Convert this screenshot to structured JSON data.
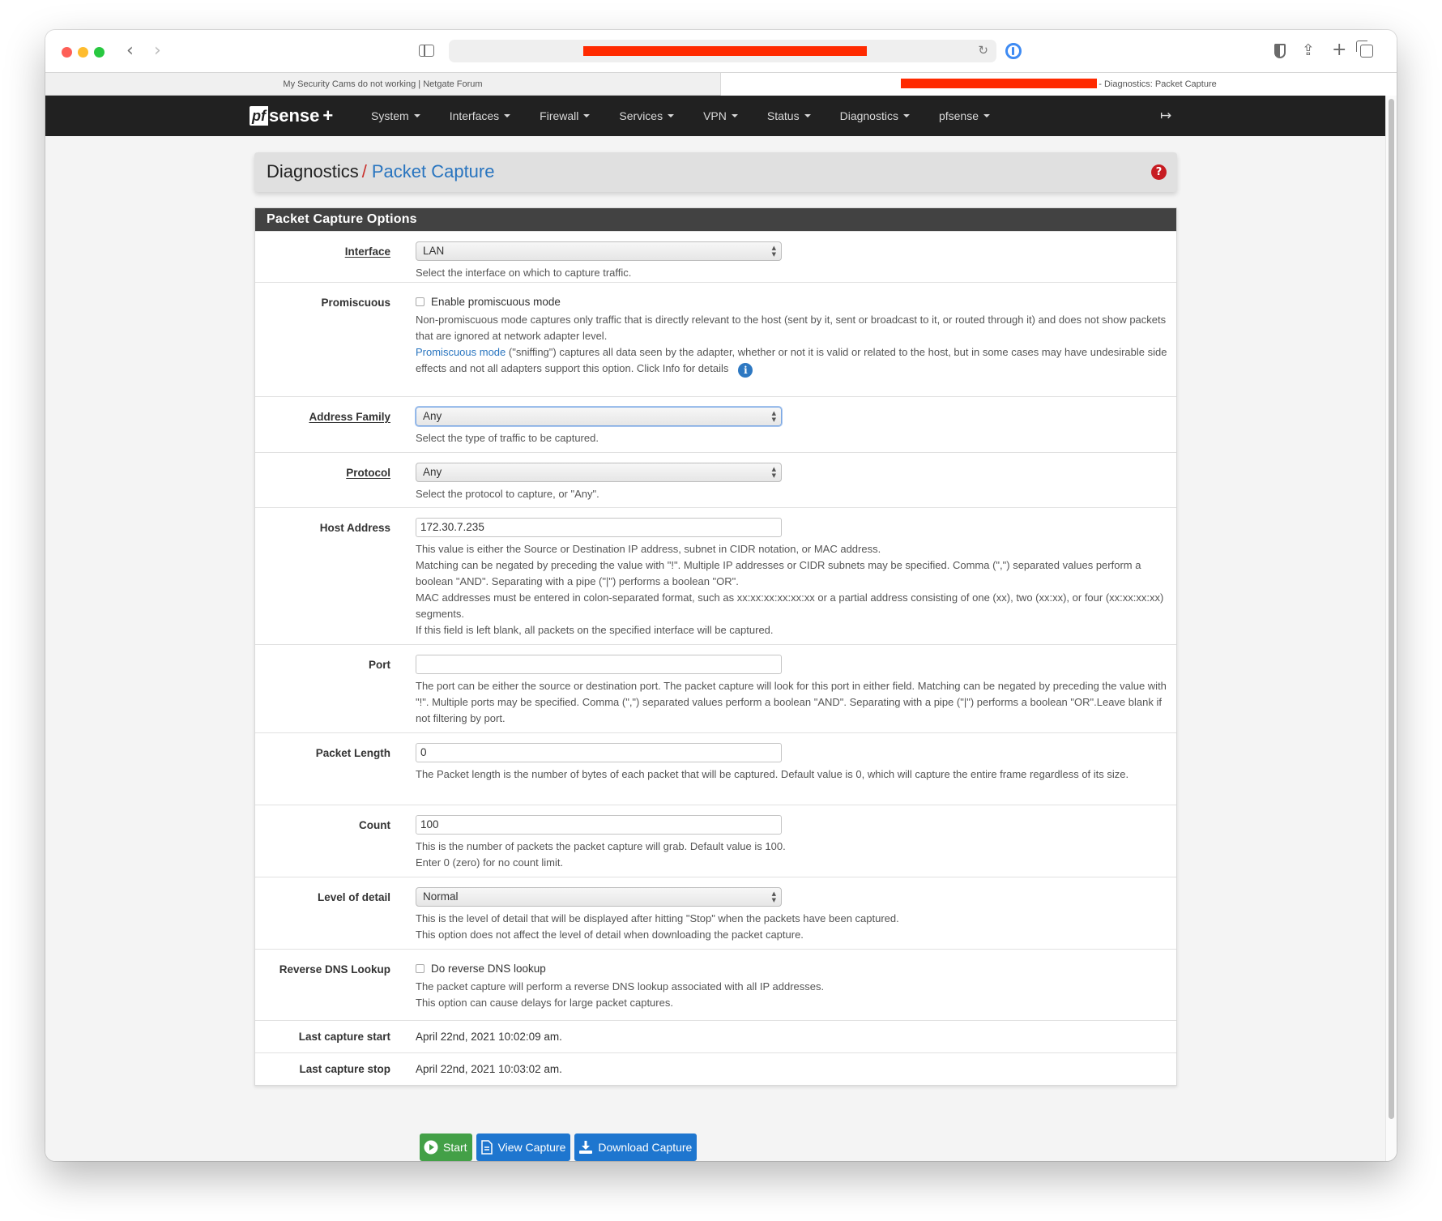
{
  "browser": {
    "tabs": [
      {
        "label": "My Security Cams do not working | Netgate Forum",
        "active": false
      },
      {
        "label": "- Diagnostics: Packet Capture",
        "active": true
      }
    ]
  },
  "nav": {
    "logo_pf": "pf",
    "logo_sense": "sense",
    "logo_plus": "+",
    "items": [
      {
        "label": "System"
      },
      {
        "label": "Interfaces"
      },
      {
        "label": "Firewall"
      },
      {
        "label": "Services"
      },
      {
        "label": "VPN"
      },
      {
        "label": "Status"
      },
      {
        "label": "Diagnostics"
      },
      {
        "label": "pfsense"
      }
    ]
  },
  "breadcrumb": {
    "parent": "Diagnostics",
    "separator": "/",
    "current": "Packet Capture"
  },
  "panel": {
    "title": "Packet Capture Options",
    "interface": {
      "label": "Interface",
      "value": "LAN",
      "help": "Select the interface on which to capture traffic."
    },
    "promiscuous": {
      "label": "Promiscuous",
      "checkbox_label": "Enable promiscuous mode",
      "checked": false,
      "help1": "Non-promiscuous mode captures only traffic that is directly relevant to the host (sent by it, sent or broadcast to it, or routed through it) and does not show packets that are ignored at network adapter level.",
      "help2_link": "Promiscuous mode",
      "help2_text": " (\"sniffing\") captures all data seen by the adapter, whether or not it is valid or related to the host, but in some cases may have undesirable side effects and not all adapters support this option. Click Info for details"
    },
    "address_family": {
      "label": "Address Family",
      "value": "Any",
      "help": "Select the type of traffic to be captured."
    },
    "protocol": {
      "label": "Protocol",
      "value": "Any",
      "help": "Select the protocol to capture, or \"Any\"."
    },
    "host_address": {
      "label": "Host Address",
      "value": "172.30.7.235",
      "help1": "This value is either the Source or Destination IP address, subnet in CIDR notation, or MAC address.",
      "help2": "Matching can be negated by preceding the value with \"!\". Multiple IP addresses or CIDR subnets may be specified. Comma (\",\") separated values perform a boolean \"AND\". Separating with a pipe (\"|\") performs a boolean \"OR\".",
      "help3": "MAC addresses must be entered in colon-separated format, such as xx:xx:xx:xx:xx:xx or a partial address consisting of one (xx), two (xx:xx), or four (xx:xx:xx:xx) segments.",
      "help4": "If this field is left blank, all packets on the specified interface will be captured."
    },
    "port": {
      "label": "Port",
      "value": "",
      "help": "The port can be either the source or destination port. The packet capture will look for this port in either field. Matching can be negated by preceding the value with \"!\". Multiple ports may be specified. Comma (\",\") separated values perform a boolean \"AND\". Separating with a pipe (\"|\") performs a boolean \"OR\".Leave blank if not filtering by port."
    },
    "packet_length": {
      "label": "Packet Length",
      "value": "0",
      "help": "The Packet length is the number of bytes of each packet that will be captured. Default value is 0, which will capture the entire frame regardless of its size."
    },
    "count": {
      "label": "Count",
      "value": "100",
      "help1": "This is the number of packets the packet capture will grab. Default value is 100.",
      "help2": "Enter 0 (zero) for no count limit."
    },
    "level_of_detail": {
      "label": "Level of detail",
      "value": "Normal",
      "help1": "This is the level of detail that will be displayed after hitting \"Stop\" when the packets have been captured.",
      "help2": "This option does not affect the level of detail when downloading the packet capture."
    },
    "reverse_dns": {
      "label": "Reverse DNS Lookup",
      "checkbox_label": "Do reverse DNS lookup",
      "checked": false,
      "help1": "The packet capture will perform a reverse DNS lookup associated with all IP addresses.",
      "help2": "This option can cause delays for large packet captures."
    },
    "last_start": {
      "label": "Last capture start",
      "value": "April 22nd, 2021 10:02:09 am."
    },
    "last_stop": {
      "label": "Last capture stop",
      "value": "April 22nd, 2021 10:03:02 am."
    }
  },
  "buttons": {
    "start": "Start",
    "view": "View Capture",
    "download": "Download Capture"
  },
  "colors": {
    "nav_bg": "#212121",
    "panel_head": "#424242",
    "link": "#2874bf",
    "start_button": "#43a047",
    "action_button": "#1e76cf",
    "help_icon": "#c71c22"
  }
}
